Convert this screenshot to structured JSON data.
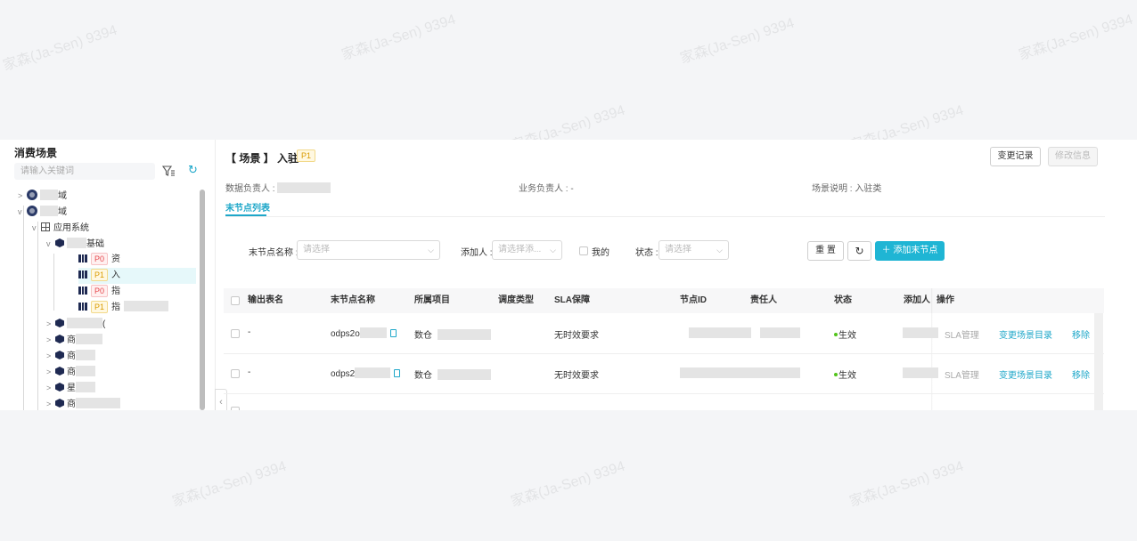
{
  "sidebar": {
    "title": "消费场景",
    "search_placeholder": "请输入关键词",
    "tree": {
      "domain1_label": "域",
      "domain2_label": "域",
      "app_system": "应用系统",
      "group_label": "基础",
      "leaf1": {
        "badge": "P0",
        "label": "资"
      },
      "leaf2": {
        "badge": "P1",
        "label": "入"
      },
      "leaf3": {
        "badge": "P0",
        "label": "指"
      },
      "leaf4": {
        "badge": "P1",
        "label": "指"
      },
      "more1_label": "(",
      "more2_label": "商",
      "more3_label": "商",
      "more4_label": "商",
      "more5_label": "星",
      "more6_label": "商"
    }
  },
  "header": {
    "title": "【 场景 】 入驻",
    "badge": "P1",
    "change_log_button": "变更记录",
    "edit_button": "修改信息"
  },
  "meta": {
    "data_owner": "数据负责人 :",
    "biz_owner": "业务负责人 : -",
    "scene_desc": "场景说明 : 入驻类"
  },
  "tab": "末节点列表",
  "filters": {
    "node_name_label": "末节点名称 :",
    "node_name_placeholder": "请选择",
    "adder_label": "添加人 :",
    "adder_placeholder": "请选择添...",
    "mine_label": "我的",
    "status_label": "状态 :",
    "status_placeholder": "请选择",
    "reset_button": "重 置",
    "add_button": "添加末节点"
  },
  "table": {
    "columns": [
      "输出表名",
      "末节点名称",
      "所属项目",
      "调度类型",
      "SLA保障",
      "节点ID",
      "责任人",
      "状态",
      "添加人",
      "操作"
    ],
    "rows": [
      {
        "output": "-",
        "node": "odps2o",
        "project": "数仓",
        "sla": "无时效要求",
        "status": "生效",
        "action_sla": "SLA管理",
        "action_change": "变更场景目录",
        "action_remove": "移除"
      },
      {
        "output": "-",
        "node": "odps2",
        "project": "数仓",
        "sla": "无时效要求",
        "status": "生效",
        "action_sla": "SLA管理",
        "action_change": "变更场景目录",
        "action_remove": "移除"
      }
    ]
  },
  "watermark": "家森(Ja-Sen) 9394",
  "colors": {
    "accent": "#1fb5d4",
    "p0": "#e5484d",
    "p1": "#d99a00",
    "active": "#52c41a"
  }
}
